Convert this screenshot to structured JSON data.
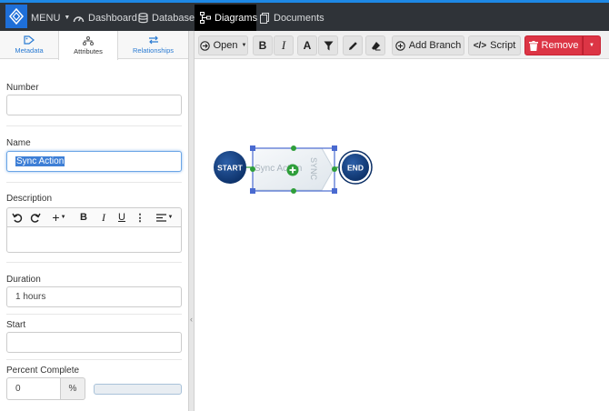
{
  "nav": {
    "menu_label": "MENU",
    "items": [
      {
        "label": "Dashboard",
        "icon": "dashboard-icon"
      },
      {
        "label": "Database",
        "icon": "database-icon"
      },
      {
        "label": "Diagrams",
        "icon": "diagram-icon",
        "active": true
      },
      {
        "label": "Documents",
        "icon": "documents-icon"
      }
    ]
  },
  "panel_tabs": [
    {
      "label": "Metadata",
      "icon": "tag-icon"
    },
    {
      "label": "Attributes",
      "icon": "hierarchy-icon",
      "active": true
    },
    {
      "label": "Relationships",
      "icon": "swap-icon"
    }
  ],
  "form": {
    "number_label": "Number",
    "number_value": "",
    "name_label": "Name",
    "name_value": "Sync Action",
    "description_label": "Description",
    "duration_label": "Duration",
    "duration_value": "1 hours",
    "start_label": "Start",
    "start_value": "",
    "percent_label": "Percent Complete",
    "percent_value": "0",
    "percent_unit": "%",
    "percent_progress": 0
  },
  "toolbar": {
    "open_label": "Open",
    "add_branch_label": "Add Branch",
    "script_label": "Script",
    "remove_label": "Remove"
  },
  "diagram": {
    "start_label": "START",
    "end_label": "END",
    "action_label": "Sync Action",
    "action_tag": "SYNC"
  },
  "colors": {
    "accent": "#1e88e5",
    "topbar": "#2f3338",
    "node_dark": "#0d3c7a",
    "selection": "#4a6ad0",
    "connector": "#2e9e3a",
    "danger": "#dc3545"
  }
}
